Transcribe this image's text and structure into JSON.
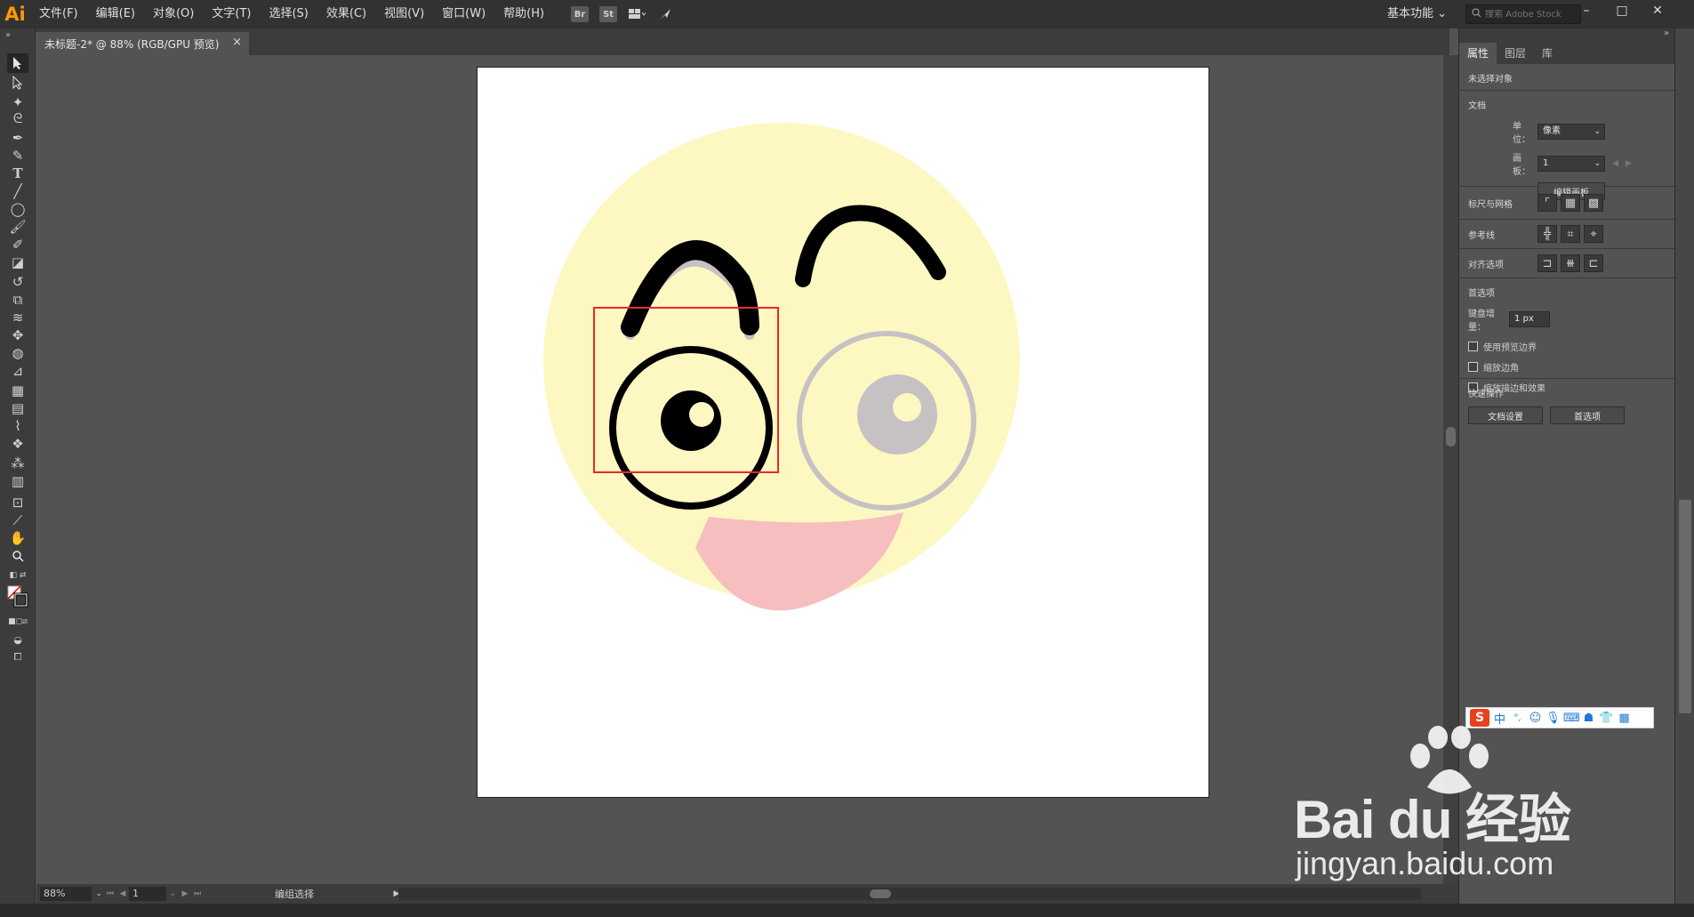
{
  "app": {
    "logo": "Ai"
  },
  "menu": [
    "文件(F)",
    "编辑(E)",
    "对象(O)",
    "文字(T)",
    "选择(S)",
    "效果(C)",
    "视图(V)",
    "窗口(W)",
    "帮助(H)"
  ],
  "menubar_buttons": {
    "bridge": "Br",
    "stock": "St"
  },
  "workspace": "基本功能",
  "search": {
    "placeholder": "搜索 Adobe Stock"
  },
  "window_controls": {
    "minimize": "–",
    "restore": "□",
    "close": "✕"
  },
  "document_tab": {
    "title": "未标题-2* @ 88% (RGB/GPU 预览)",
    "close": "×"
  },
  "statusbar": {
    "zoom": "88%",
    "page": "1",
    "status": "编组选择"
  },
  "panel": {
    "tabs": [
      "属性",
      "图层",
      "库"
    ],
    "no_selection": "未选择对象",
    "document_title": "文档",
    "units_label": "单位：",
    "units_value": "像素",
    "artboard_label": "画板：",
    "artboard_value": "1",
    "edit_artboards": "编辑画板",
    "rulers_grids": "标尺与网格",
    "guides": "参考线",
    "snap_options": "对齐选项",
    "preferences_title": "首选项",
    "keyboard_increment_label": "键盘增量：",
    "keyboard_increment_value": "1 px",
    "check_preview_bounds": "使用预览边界",
    "check_scale_corners": "缩放边角",
    "check_scale_strokes": "缩放描边和效果",
    "quick_actions": "快速操作",
    "doc_setup": "文档设置",
    "preferences_btn": "首选项"
  },
  "ime": {
    "logo": "S",
    "mode": "中",
    "punct": "°,"
  },
  "watermark": {
    "brand": "Bai du 经验",
    "url": "jingyan.baidu.com"
  },
  "colors": {
    "face": "#fdf7c2",
    "mouth": "#f7bec0",
    "stroke": "#000000",
    "ghost": "#c6c1c3",
    "selection": "#e82a2a",
    "accent": "#ff9a00"
  },
  "icons": [
    "selection-icon",
    "direct-selection-icon",
    "magic-wand-icon",
    "lasso-icon",
    "pen-icon",
    "curvature-icon",
    "type-icon",
    "line-icon",
    "ellipse-icon",
    "paintbrush-icon",
    "shaper-icon",
    "eraser-icon",
    "rotate-icon",
    "scale-icon",
    "warp-icon",
    "puppet-warp-icon",
    "shape-builder-icon",
    "perspective-icon",
    "mesh-icon",
    "gradient-icon",
    "eyedropper-icon",
    "blend-icon",
    "symbol-sprayer-icon",
    "graph-icon",
    "artboard-icon",
    "slice-icon",
    "hand-icon",
    "zoom-icon"
  ]
}
